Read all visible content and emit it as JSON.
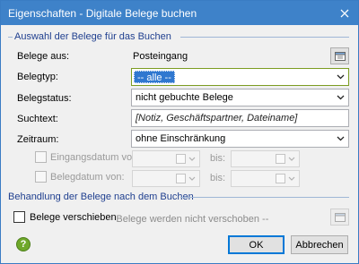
{
  "window": {
    "title": "Eigenschaften - Digitale Belege buchen",
    "close_icon": "close-icon"
  },
  "group1": {
    "label": "Auswahl der Belege für das Buchen",
    "belege_aus_label": "Belege aus:",
    "belege_aus_value": "Posteingang",
    "belegtyp_label": "Belegtyp:",
    "belegtyp_value": "-- alle --",
    "belegstatus_label": "Belegstatus:",
    "belegstatus_value": "nicht gebuchte Belege",
    "suchtext_label": "Suchtext:",
    "suchtext_value": "[Notiz, Geschäftspartner, Dateiname]",
    "zeitraum_label": "Zeitraum:",
    "zeitraum_value": "ohne Einschränkung",
    "eingangsdatum_label": "Eingangsdatum von:",
    "belegdatum_label": "Belegdatum von:",
    "bis_label": "bis:"
  },
  "group2": {
    "label": "Behandlung der Belege nach dem Buchen",
    "verschieben_label": "Belege verschieben",
    "verschieben_info": "-- Belege werden nicht verschoben --"
  },
  "footer": {
    "help_label": "?",
    "ok_label": "OK",
    "cancel_label": "Abbrechen"
  },
  "colors": {
    "titlebar": "#3e82c9",
    "group_label": "#1f3f8f",
    "selection": "#3078d0",
    "help": "#6fa82a"
  }
}
